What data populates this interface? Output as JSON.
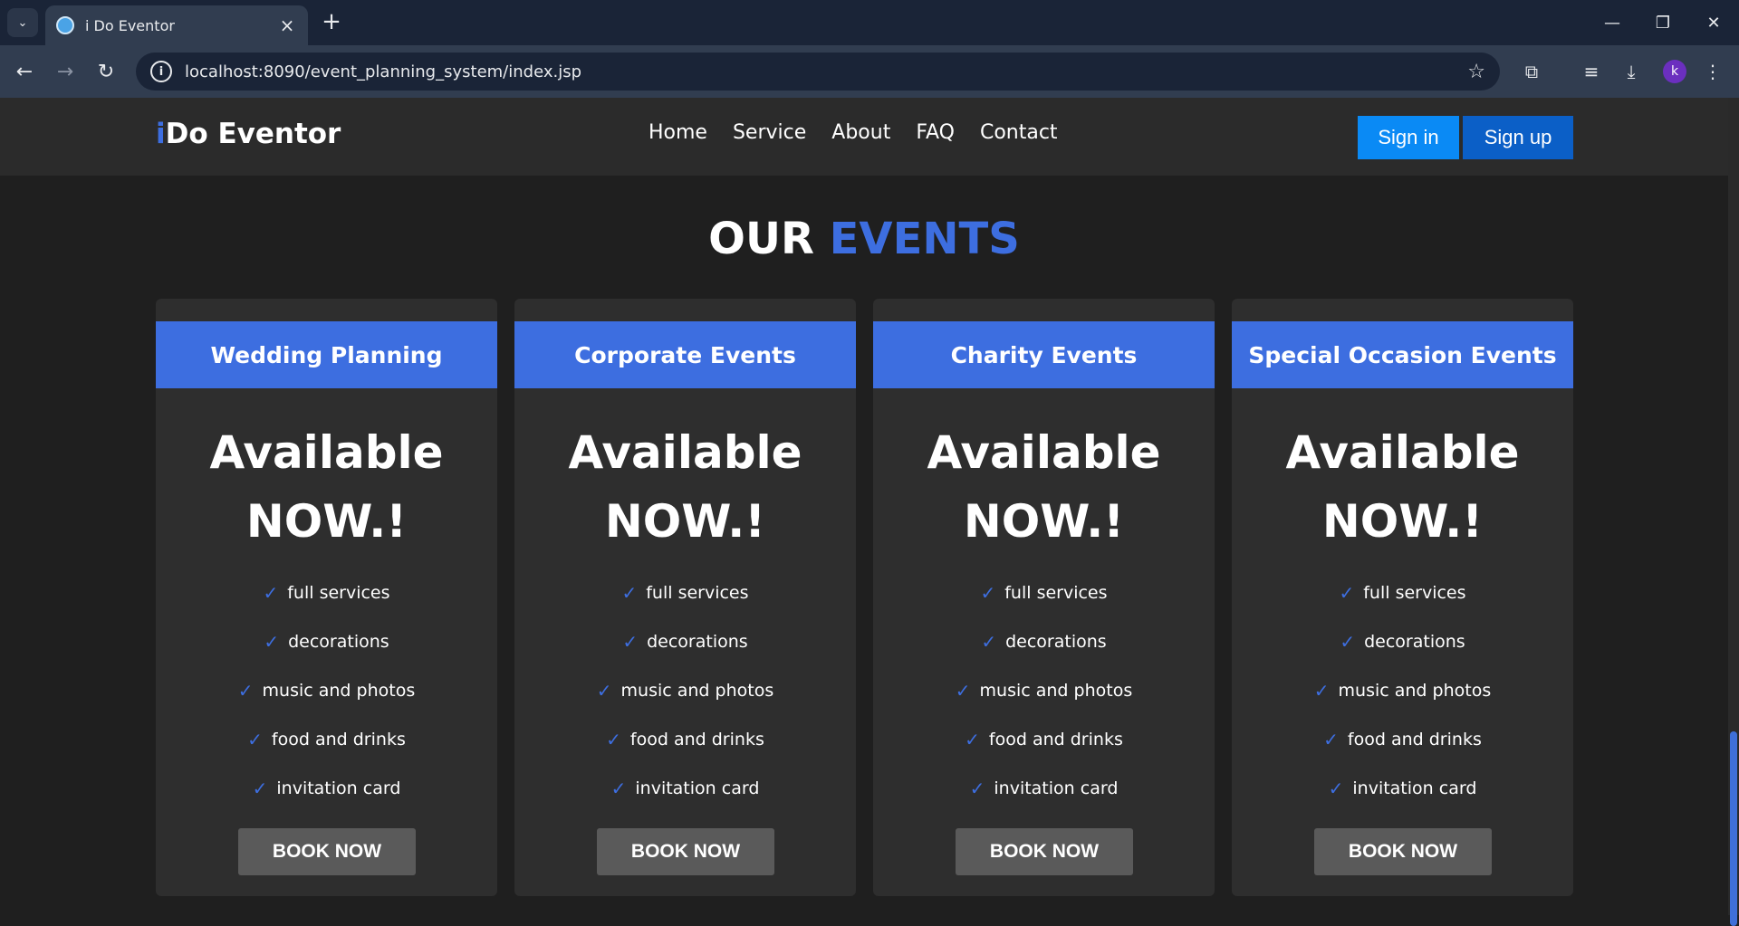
{
  "browser": {
    "tab_title": "i Do Eventor",
    "url": "localhost:8090/event_planning_system/index.jsp",
    "avatar_letter": "k"
  },
  "header": {
    "logo_i": "i",
    "logo_rest": "Do Eventor",
    "nav": [
      "Home",
      "Service",
      "About",
      "FAQ",
      "Contact"
    ],
    "signin_label": "Sign in",
    "signup_label": "Sign up"
  },
  "section": {
    "title_part1": "OUR",
    "title_part2": "EVENTS"
  },
  "cards": [
    {
      "title": "Wedding Planning",
      "avail_line1": "Available",
      "avail_line2": "NOW.!",
      "features": [
        "full services",
        "decorations",
        "music and photos",
        "food and drinks",
        "invitation card"
      ],
      "button": "BOOK NOW"
    },
    {
      "title": "Corporate Events",
      "avail_line1": "Available",
      "avail_line2": "NOW.!",
      "features": [
        "full services",
        "decorations",
        "music and photos",
        "food and drinks",
        "invitation card"
      ],
      "button": "BOOK NOW"
    },
    {
      "title": "Charity Events",
      "avail_line1": "Available",
      "avail_line2": "NOW.!",
      "features": [
        "full services",
        "decorations",
        "music and photos",
        "food and drinks",
        "invitation card"
      ],
      "button": "BOOK NOW"
    },
    {
      "title": "Special Occasion Events",
      "avail_line1": "Available",
      "avail_line2": "NOW.!",
      "features": [
        "full services",
        "decorations",
        "music and photos",
        "food and drinks",
        "invitation card"
      ],
      "button": "BOOK NOW"
    }
  ],
  "colors": {
    "accent": "#3d6ee0",
    "signin": "#0a8af5",
    "signup": "#0b5fc7",
    "page_bg": "#1f1f1f",
    "card_bg": "#2e2e2e"
  },
  "icons": {
    "check": "checkmark-icon",
    "tab_search": "chevron-down-icon"
  }
}
